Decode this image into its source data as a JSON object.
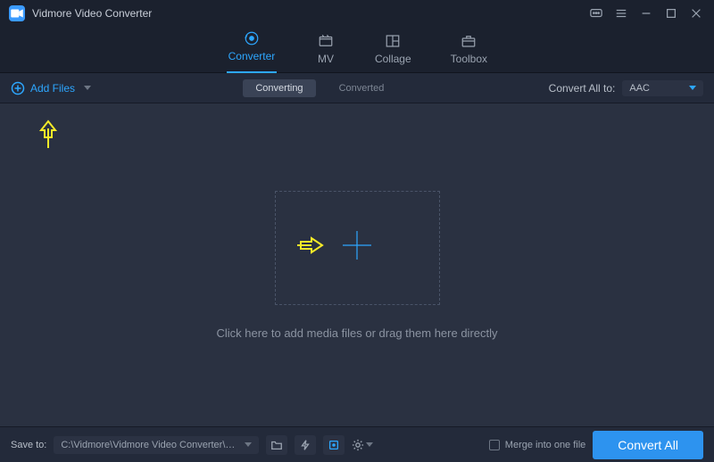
{
  "app": {
    "title": "Vidmore Video Converter"
  },
  "tabs": {
    "converter": "Converter",
    "mv": "MV",
    "collage": "Collage",
    "toolbox": "Toolbox"
  },
  "subbar": {
    "add_files": "Add Files",
    "converting": "Converting",
    "converted": "Converted",
    "convert_all_to": "Convert All to:",
    "format": "AAC"
  },
  "workspace": {
    "hint": "Click here to add media files or drag them here directly"
  },
  "footer": {
    "save_to_label": "Save to:",
    "save_path": "C:\\Vidmore\\Vidmore Video Converter\\Converted",
    "merge_label": "Merge into one file",
    "convert_button": "Convert All"
  }
}
